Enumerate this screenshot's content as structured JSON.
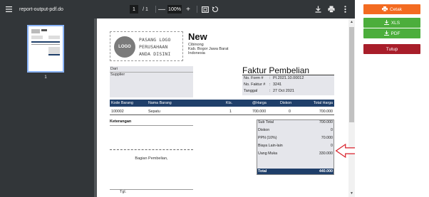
{
  "viewer": {
    "file_name": "report-output-pdf.do",
    "page_current": "1",
    "page_total": "/ 1",
    "zoom": "100%",
    "zoom_out": "—",
    "zoom_in": "+",
    "thumbnail_page": "1"
  },
  "invoice": {
    "logo_circle": "LOGO",
    "logo_line1": "PASANG LOGO",
    "logo_line2": "PERUSAHAAN",
    "logo_line3": "ANDA DISINI",
    "company": "New",
    "address_line1": "Cibinong",
    "address_line2": "Kab. Bogor Jawa Barat",
    "address_line3": "Indonesia",
    "from_label": "Dari",
    "supplier_label": "Supplier",
    "title": "Faktur Pembelian",
    "fields": [
      {
        "key": "No. Form #",
        "sep": ":",
        "value": "PI.2021.10.00012"
      },
      {
        "key": "No. Faktur #",
        "sep": ":",
        "value": "3241"
      },
      {
        "key": "Tanggal",
        "sep": ":",
        "value": "27 Oct 2021"
      }
    ],
    "table_headers": {
      "kode": "Kode Barang",
      "nama": "Nama Barang",
      "kts": "Kts.",
      "harga": "@Harga",
      "diskon": "Diskon",
      "total": "Total Harga"
    },
    "row": {
      "kode": "100002",
      "nama": "Sepatu",
      "kts": "1",
      "harga": "700.000",
      "diskon": "0",
      "total": "700.000"
    },
    "notes_label": "Keterangan",
    "signature_label": "Bagian Pembelian,",
    "date_label": "Tgl.",
    "summary": [
      {
        "label": "Sub Total",
        "value": "700.000"
      },
      {
        "label": "Diskon",
        "value": "0"
      },
      {
        "label": "PPN (10%)",
        "value": "70.000"
      },
      {
        "label": "Biaya Lain-lain",
        "value": "0"
      },
      {
        "label": "Uang Muka",
        "value": "330.000"
      }
    ],
    "total_label": "Total",
    "total_value": "440.000"
  },
  "actions": {
    "cetak": "Cetak",
    "xls": "XLS",
    "pdf": "PDF",
    "tutup": "Tutup"
  },
  "colors": {
    "toolbar": "#323639",
    "viewer_bg": "#525659",
    "table_header": "#1f3f6a",
    "cetak": "#f36b21",
    "export": "#4cae3c",
    "tutup": "#a81e2a",
    "arrow": "#d9212b"
  },
  "icons": [
    "menu-icon",
    "fit-page-icon",
    "rotate-icon",
    "download-icon",
    "print-icon",
    "more-vert-icon",
    "print-icon",
    "download-icon"
  ]
}
